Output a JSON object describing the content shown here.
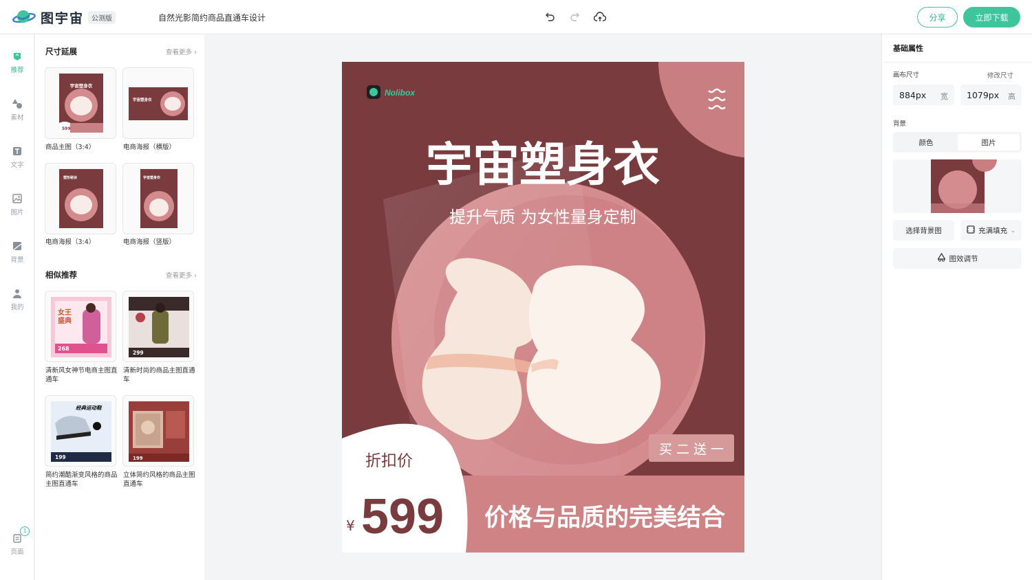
{
  "app": {
    "brand": "图宇宙",
    "badge": "公测版",
    "doc_title": "自然光影简约商品直通车设计"
  },
  "toolbar": {
    "undo_icon": "undo-icon",
    "redo_icon": "redo-icon",
    "cloud_save_icon": "cloud-save-icon",
    "share_label": "分享",
    "download_label": "立即下载"
  },
  "colors": {
    "accent": "#3fc59c",
    "poster_dark": "#7a3b3f",
    "poster_light": "#d38b8e"
  },
  "nav": {
    "items": [
      {
        "label": "推荐",
        "icon": "recommend-icon"
      },
      {
        "label": "素材",
        "icon": "shapes-icon"
      },
      {
        "label": "文字",
        "icon": "text-icon"
      },
      {
        "label": "图片",
        "icon": "image-icon"
      },
      {
        "label": "背景",
        "icon": "background-icon"
      },
      {
        "label": "我的",
        "icon": "user-icon"
      }
    ],
    "pages_label": "页面",
    "pages_count": "1"
  },
  "panel": {
    "size_section": {
      "title": "尺寸延展",
      "more": "查看更多",
      "cards": [
        {
          "label": "商品主图（3:4）",
          "thumb_title": "宇宙塑身衣",
          "thumb_price": "599"
        },
        {
          "label": "电商海报（横版）",
          "thumb_title": "宇宙塑身衣"
        },
        {
          "label": "电商海报（3:4）",
          "thumb_title": "塑形秘诀\n隐形の收美"
        },
        {
          "label": "电商海报（竖版）",
          "thumb_title": "宇宙塑身衣\n定义 无束缚"
        }
      ]
    },
    "similar_section": {
      "title": "相似推荐",
      "more": "查看更多",
      "cards": [
        {
          "label": "清新风女神节电商主图直通车",
          "thumb_title": "女王\n盛典",
          "thumb_price": "268"
        },
        {
          "label": "清新时尚的商品主图直通车",
          "thumb_price": "299"
        },
        {
          "label": "简约潮酷渐变风格的商品主图直通车",
          "thumb_title": "经典运动鞋",
          "thumb_price": "199"
        },
        {
          "label": "立体简约风格的商品主图直通车",
          "thumb_price": "199"
        }
      ]
    }
  },
  "poster": {
    "brand": "Nolibox",
    "title": "宇宙塑身衣",
    "subtitle": "提升气质 为女性量身定制",
    "promo_tag": "买 二 送 一",
    "price_label": "折扣价",
    "currency": "¥",
    "price": "599",
    "slogan": "价格与品质的完美结合"
  },
  "props": {
    "title": "基础属性",
    "canvas_size_label": "画布尺寸",
    "modify_size_link": "修改尺寸",
    "width_value": "884px",
    "width_unit": "宽",
    "height_value": "1079px",
    "height_unit": "高",
    "background_label": "背景",
    "bg_tabs": [
      "颜色",
      "图片"
    ],
    "bg_tab_selected": "图片",
    "choose_bg_label": "选择背景图",
    "fill_mode_label": "充满填充",
    "effect_label": "图效调节"
  }
}
